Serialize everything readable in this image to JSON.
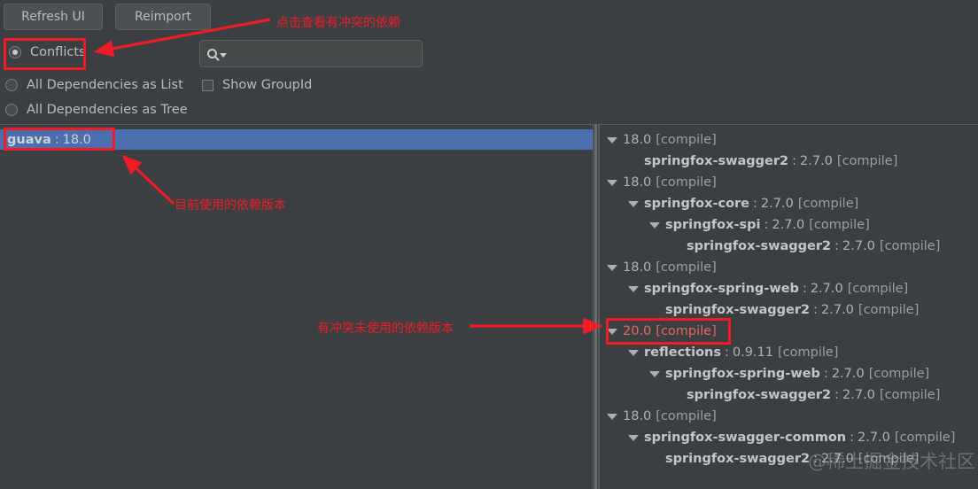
{
  "toolbar": {
    "refresh_label": "Refresh UI",
    "reimport_label": "Reimport"
  },
  "options": {
    "conflicts_label": "Conflicts",
    "all_as_list_label": "All Dependencies as List",
    "all_as_tree_label": "All Dependencies as Tree",
    "show_groupid_label": "Show GroupId"
  },
  "search": {
    "value": "",
    "placeholder": ""
  },
  "left_panel": {
    "selected": {
      "artifact": "guava",
      "separator": ":",
      "version": "18.0"
    }
  },
  "right_panel": {
    "rows": [
      {
        "indent": 0,
        "arrow": true,
        "artifact": "",
        "version": "18.0",
        "scope": "[compile]",
        "conflict": false
      },
      {
        "indent": 1,
        "arrow": false,
        "artifact": "springfox-swagger2",
        "version": "2.7.0",
        "scope": "[compile]",
        "conflict": false
      },
      {
        "indent": 0,
        "arrow": true,
        "artifact": "",
        "version": "18.0",
        "scope": "[compile]",
        "conflict": false
      },
      {
        "indent": 1,
        "arrow": true,
        "artifact": "springfox-core",
        "version": "2.7.0",
        "scope": "[compile]",
        "conflict": false
      },
      {
        "indent": 2,
        "arrow": true,
        "artifact": "springfox-spi",
        "version": "2.7.0",
        "scope": "[compile]",
        "conflict": false
      },
      {
        "indent": 3,
        "arrow": false,
        "artifact": "springfox-swagger2",
        "version": "2.7.0",
        "scope": "[compile]",
        "conflict": false
      },
      {
        "indent": 0,
        "arrow": true,
        "artifact": "",
        "version": "18.0",
        "scope": "[compile]",
        "conflict": false
      },
      {
        "indent": 1,
        "arrow": true,
        "artifact": "springfox-spring-web",
        "version": "2.7.0",
        "scope": "[compile]",
        "conflict": false
      },
      {
        "indent": 2,
        "arrow": false,
        "artifact": "springfox-swagger2",
        "version": "2.7.0",
        "scope": "[compile]",
        "conflict": false
      },
      {
        "indent": 0,
        "arrow": true,
        "artifact": "",
        "version": "20.0",
        "scope": "[compile]",
        "conflict": true
      },
      {
        "indent": 1,
        "arrow": true,
        "artifact": "reflections",
        "version": "0.9.11",
        "scope": "[compile]",
        "conflict": false
      },
      {
        "indent": 2,
        "arrow": true,
        "artifact": "springfox-spring-web",
        "version": "2.7.0",
        "scope": "[compile]",
        "conflict": false
      },
      {
        "indent": 3,
        "arrow": false,
        "artifact": "springfox-swagger2",
        "version": "2.7.0",
        "scope": "[compile]",
        "conflict": false
      },
      {
        "indent": 0,
        "arrow": true,
        "artifact": "",
        "version": "18.0",
        "scope": "[compile]",
        "conflict": false
      },
      {
        "indent": 1,
        "arrow": true,
        "artifact": "springfox-swagger-common",
        "version": "2.7.0",
        "scope": "[compile]",
        "conflict": false
      },
      {
        "indent": 2,
        "arrow": false,
        "artifact": "springfox-swagger2",
        "version": "2.7.0",
        "scope": "[compile]",
        "conflict": false
      }
    ]
  },
  "annotations": {
    "click_to_view": "点击查看有冲突的依赖",
    "current_version": "目前使用的依赖版本",
    "conflict_unused_version": "有冲突未使用的依赖版本",
    "color": "#ee1c25"
  },
  "watermark": {
    "text": "@稀土掘金技术社区"
  }
}
